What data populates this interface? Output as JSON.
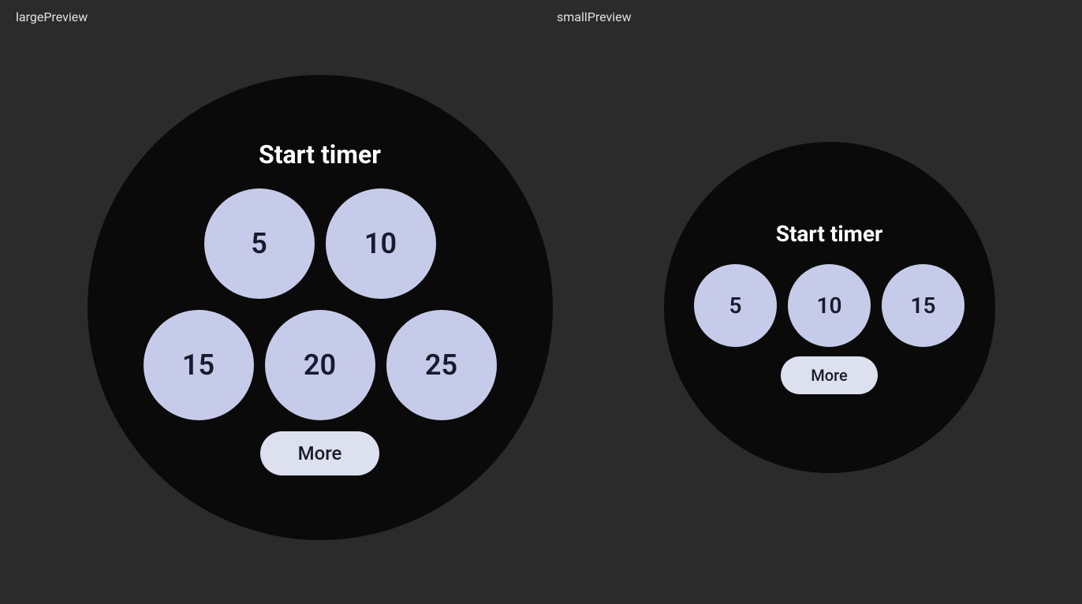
{
  "labels": {
    "large_preview": "largePreview",
    "small_preview": "smallPreview"
  },
  "large_watch": {
    "title": "Start timer",
    "row1": [
      "5",
      "10"
    ],
    "row2": [
      "15",
      "20",
      "25"
    ],
    "more_label": "More"
  },
  "small_watch": {
    "title": "Start timer",
    "row1": [
      "5",
      "10",
      "15"
    ],
    "more_label": "More"
  },
  "colors": {
    "background": "#2b2b2b",
    "watch_face": "#0a0a0a",
    "timer_btn": "#c5cbe8",
    "more_btn": "#dde0ef",
    "text_white": "#ffffff",
    "text_dark": "#1a1a2e"
  }
}
